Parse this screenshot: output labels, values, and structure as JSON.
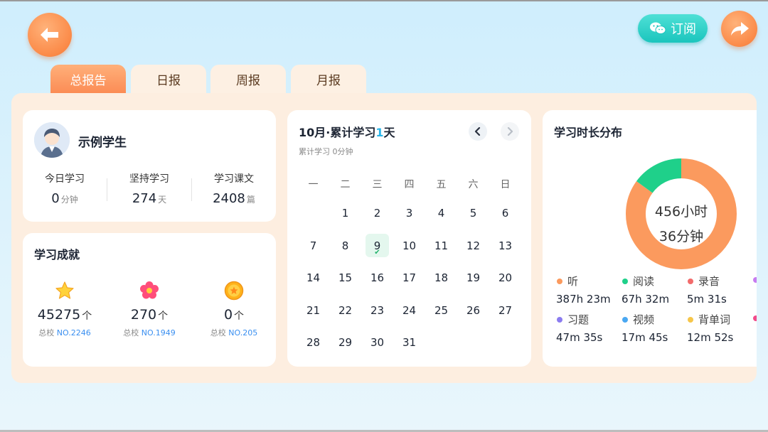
{
  "header": {
    "subscribe_label": "订阅"
  },
  "tabs": [
    {
      "label": "总报告",
      "active": true
    },
    {
      "label": "日报",
      "active": false
    },
    {
      "label": "周报",
      "active": false
    },
    {
      "label": "月报",
      "active": false
    }
  ],
  "profile": {
    "name": "示例学生",
    "stats": [
      {
        "label": "今日学习",
        "value": "0",
        "unit": "分钟"
      },
      {
        "label": "坚持学习",
        "value": "274",
        "unit": "天"
      },
      {
        "label": "学习课文",
        "value": "2408",
        "unit": "篇"
      }
    ]
  },
  "achievements": {
    "title": "学习成就",
    "items": [
      {
        "icon": "star-icon",
        "value": "45275",
        "unit": "个",
        "rank_prefix": "总校",
        "rank_no": "NO.2246"
      },
      {
        "icon": "flower-icon",
        "value": "270",
        "unit": "个",
        "rank_prefix": "总校",
        "rank_no": "NO.1949"
      },
      {
        "icon": "medal-icon",
        "value": "0",
        "unit": "个",
        "rank_prefix": "总校",
        "rank_no": "NO.205"
      }
    ]
  },
  "calendar": {
    "title_prefix": "10月·累计学习",
    "title_count": "1",
    "title_suffix": "天",
    "subtitle": "累计学习 0分钟",
    "weekdays": [
      "一",
      "二",
      "三",
      "四",
      "五",
      "六",
      "日"
    ],
    "weeks": [
      [
        "",
        "1",
        "2",
        "3",
        "4",
        "5",
        "6"
      ],
      [
        "7",
        "8",
        "9",
        "10",
        "11",
        "12",
        "13"
      ],
      [
        "14",
        "15",
        "16",
        "17",
        "18",
        "19",
        "20"
      ],
      [
        "21",
        "22",
        "23",
        "24",
        "25",
        "26",
        "27"
      ],
      [
        "28",
        "29",
        "30",
        "31",
        "",
        "",
        ""
      ]
    ],
    "checked_day": "9",
    "check_mark": "✔"
  },
  "distribution": {
    "title": "学习时长分布",
    "total_line1": "456小时",
    "total_line2": "36分钟",
    "colors": {
      "listen": "#fb9a5e",
      "read": "#1fd08a",
      "record": "#f26b6b",
      "exercise": "#8b7cf0",
      "video": "#4aa8f2",
      "words": "#f6c64a"
    },
    "legend": [
      {
        "label": "听",
        "value": "387h 23m",
        "color": "#fb9a5e"
      },
      {
        "label": "阅读",
        "value": "67h 32m",
        "color": "#1fd08a"
      },
      {
        "label": "录音",
        "value": "5m 31s",
        "color": "#f26b6b"
      },
      {
        "label": "习题",
        "value": "47m 35s",
        "color": "#8b7cf0"
      },
      {
        "label": "视频",
        "value": "17m 45s",
        "color": "#4aa8f2"
      },
      {
        "label": "背单词",
        "value": "12m 52s",
        "color": "#f6c64a"
      }
    ],
    "donut_share": {
      "listen": 0.85,
      "read": 0.15
    }
  }
}
